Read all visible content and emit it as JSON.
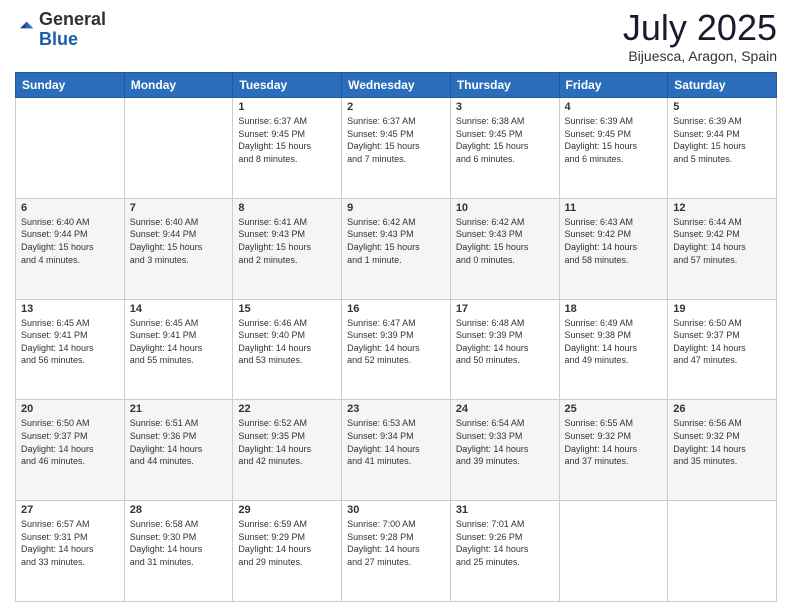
{
  "header": {
    "logo_line1": "General",
    "logo_line2": "Blue",
    "month": "July 2025",
    "location": "Bijuesca, Aragon, Spain"
  },
  "days_of_week": [
    "Sunday",
    "Monday",
    "Tuesday",
    "Wednesday",
    "Thursday",
    "Friday",
    "Saturday"
  ],
  "weeks": [
    [
      {
        "day": "",
        "info": ""
      },
      {
        "day": "",
        "info": ""
      },
      {
        "day": "1",
        "info": "Sunrise: 6:37 AM\nSunset: 9:45 PM\nDaylight: 15 hours\nand 8 minutes."
      },
      {
        "day": "2",
        "info": "Sunrise: 6:37 AM\nSunset: 9:45 PM\nDaylight: 15 hours\nand 7 minutes."
      },
      {
        "day": "3",
        "info": "Sunrise: 6:38 AM\nSunset: 9:45 PM\nDaylight: 15 hours\nand 6 minutes."
      },
      {
        "day": "4",
        "info": "Sunrise: 6:39 AM\nSunset: 9:45 PM\nDaylight: 15 hours\nand 6 minutes."
      },
      {
        "day": "5",
        "info": "Sunrise: 6:39 AM\nSunset: 9:44 PM\nDaylight: 15 hours\nand 5 minutes."
      }
    ],
    [
      {
        "day": "6",
        "info": "Sunrise: 6:40 AM\nSunset: 9:44 PM\nDaylight: 15 hours\nand 4 minutes."
      },
      {
        "day": "7",
        "info": "Sunrise: 6:40 AM\nSunset: 9:44 PM\nDaylight: 15 hours\nand 3 minutes."
      },
      {
        "day": "8",
        "info": "Sunrise: 6:41 AM\nSunset: 9:43 PM\nDaylight: 15 hours\nand 2 minutes."
      },
      {
        "day": "9",
        "info": "Sunrise: 6:42 AM\nSunset: 9:43 PM\nDaylight: 15 hours\nand 1 minute."
      },
      {
        "day": "10",
        "info": "Sunrise: 6:42 AM\nSunset: 9:43 PM\nDaylight: 15 hours\nand 0 minutes."
      },
      {
        "day": "11",
        "info": "Sunrise: 6:43 AM\nSunset: 9:42 PM\nDaylight: 14 hours\nand 58 minutes."
      },
      {
        "day": "12",
        "info": "Sunrise: 6:44 AM\nSunset: 9:42 PM\nDaylight: 14 hours\nand 57 minutes."
      }
    ],
    [
      {
        "day": "13",
        "info": "Sunrise: 6:45 AM\nSunset: 9:41 PM\nDaylight: 14 hours\nand 56 minutes."
      },
      {
        "day": "14",
        "info": "Sunrise: 6:45 AM\nSunset: 9:41 PM\nDaylight: 14 hours\nand 55 minutes."
      },
      {
        "day": "15",
        "info": "Sunrise: 6:46 AM\nSunset: 9:40 PM\nDaylight: 14 hours\nand 53 minutes."
      },
      {
        "day": "16",
        "info": "Sunrise: 6:47 AM\nSunset: 9:39 PM\nDaylight: 14 hours\nand 52 minutes."
      },
      {
        "day": "17",
        "info": "Sunrise: 6:48 AM\nSunset: 9:39 PM\nDaylight: 14 hours\nand 50 minutes."
      },
      {
        "day": "18",
        "info": "Sunrise: 6:49 AM\nSunset: 9:38 PM\nDaylight: 14 hours\nand 49 minutes."
      },
      {
        "day": "19",
        "info": "Sunrise: 6:50 AM\nSunset: 9:37 PM\nDaylight: 14 hours\nand 47 minutes."
      }
    ],
    [
      {
        "day": "20",
        "info": "Sunrise: 6:50 AM\nSunset: 9:37 PM\nDaylight: 14 hours\nand 46 minutes."
      },
      {
        "day": "21",
        "info": "Sunrise: 6:51 AM\nSunset: 9:36 PM\nDaylight: 14 hours\nand 44 minutes."
      },
      {
        "day": "22",
        "info": "Sunrise: 6:52 AM\nSunset: 9:35 PM\nDaylight: 14 hours\nand 42 minutes."
      },
      {
        "day": "23",
        "info": "Sunrise: 6:53 AM\nSunset: 9:34 PM\nDaylight: 14 hours\nand 41 minutes."
      },
      {
        "day": "24",
        "info": "Sunrise: 6:54 AM\nSunset: 9:33 PM\nDaylight: 14 hours\nand 39 minutes."
      },
      {
        "day": "25",
        "info": "Sunrise: 6:55 AM\nSunset: 9:32 PM\nDaylight: 14 hours\nand 37 minutes."
      },
      {
        "day": "26",
        "info": "Sunrise: 6:56 AM\nSunset: 9:32 PM\nDaylight: 14 hours\nand 35 minutes."
      }
    ],
    [
      {
        "day": "27",
        "info": "Sunrise: 6:57 AM\nSunset: 9:31 PM\nDaylight: 14 hours\nand 33 minutes."
      },
      {
        "day": "28",
        "info": "Sunrise: 6:58 AM\nSunset: 9:30 PM\nDaylight: 14 hours\nand 31 minutes."
      },
      {
        "day": "29",
        "info": "Sunrise: 6:59 AM\nSunset: 9:29 PM\nDaylight: 14 hours\nand 29 minutes."
      },
      {
        "day": "30",
        "info": "Sunrise: 7:00 AM\nSunset: 9:28 PM\nDaylight: 14 hours\nand 27 minutes."
      },
      {
        "day": "31",
        "info": "Sunrise: 7:01 AM\nSunset: 9:26 PM\nDaylight: 14 hours\nand 25 minutes."
      },
      {
        "day": "",
        "info": ""
      },
      {
        "day": "",
        "info": ""
      }
    ]
  ]
}
